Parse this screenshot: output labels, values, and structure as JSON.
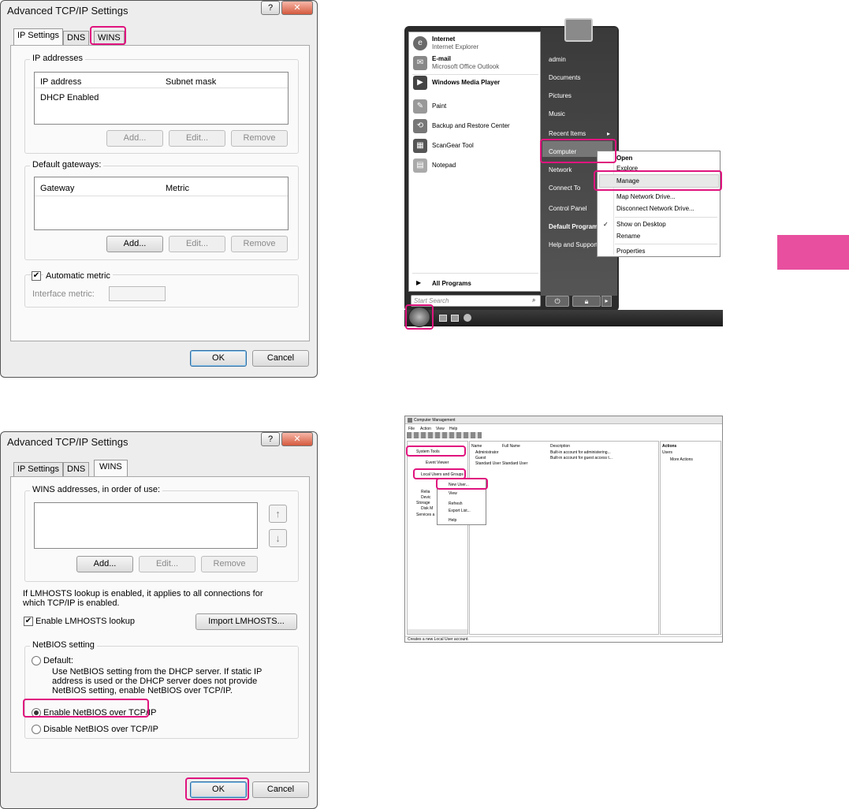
{
  "dialog1": {
    "title": "Advanced TCP/IP Settings",
    "help_label": "?",
    "close_label": "✕",
    "tabs": [
      "IP Settings",
      "DNS",
      "WINS"
    ],
    "ip_group_label": "IP addresses",
    "ip_columns": [
      "IP address",
      "Subnet mask"
    ],
    "ip_rows": [
      "DHCP Enabled"
    ],
    "ip_buttons": [
      "Add...",
      "Edit...",
      "Remove"
    ],
    "gw_group_label": "Default gateways:",
    "gw_columns": [
      "Gateway",
      "Metric"
    ],
    "gw_buttons": [
      "Add...",
      "Edit...",
      "Remove"
    ],
    "auto_metric_label": "Automatic metric",
    "auto_metric_checked": true,
    "interface_metric_label": "Interface metric:",
    "ok_label": "OK",
    "cancel_label": "Cancel"
  },
  "dialog2": {
    "title": "Advanced TCP/IP Settings",
    "help_label": "?",
    "close_label": "✕",
    "tabs": [
      "IP Settings",
      "DNS",
      "WINS"
    ],
    "wins_group_label": "WINS addresses, in order of use:",
    "up_icon": "↑",
    "down_icon": "↓",
    "wins_buttons": [
      "Add...",
      "Edit...",
      "Remove"
    ],
    "lmhosts_text": "If LMHOSTS lookup is enabled, it applies to all connections for which TCP/IP is enabled.",
    "lmhosts_checkbox": "Enable LMHOSTS lookup",
    "lmhosts_checked": true,
    "import_button": "Import LMHOSTS...",
    "netbios_group_label": "NetBIOS setting",
    "netbios_default": "Default:",
    "netbios_default_desc": "Use NetBIOS setting from the DHCP server. If static IP address is used or the DHCP server does not provide NetBIOS setting, enable NetBIOS over TCP/IP.",
    "netbios_enable": "Enable NetBIOS over TCP/IP",
    "netbios_disable": "Disable NetBIOS over TCP/IP",
    "ok_label": "OK",
    "cancel_label": "Cancel"
  },
  "start_menu": {
    "pinned": [
      {
        "title": "Internet",
        "sub": "Internet Explorer",
        "icon": "internet-explorer-icon"
      },
      {
        "title": "E-mail",
        "sub": "Microsoft Office Outlook",
        "icon": "outlook-icon"
      }
    ],
    "recent": [
      "Windows Media Player",
      "Paint",
      "Backup and Restore Center",
      "ScanGear Tool",
      "Notepad"
    ],
    "all_programs": "All Programs",
    "search_placeholder": "Start Search",
    "right_items": [
      "admin",
      "Documents",
      "Pictures",
      "Music",
      "Recent Items",
      "Computer",
      "Network",
      "Connect To",
      "Control Panel",
      "Default Programs",
      "Help and Support"
    ],
    "context_menu": [
      "Open",
      "Explore",
      "Manage",
      "Map Network Drive...",
      "Disconnect Network Drive...",
      "Show on Desktop",
      "Rename",
      "Properties"
    ]
  },
  "computer_management": {
    "title": "Computer Management",
    "menu": [
      "File",
      "Action",
      "View",
      "Help"
    ],
    "tree": [
      "System Tools",
      "Event Viewer",
      "Local Users and Groups",
      "Relia",
      "Devic",
      "Storage",
      "Disk M",
      "Services a"
    ],
    "columns": [
      "Name",
      "Full Name",
      "Description"
    ],
    "rows": [
      [
        "Administrator",
        "",
        "Built-in account for administering..."
      ],
      [
        "Guest",
        "",
        "Built-in account for guest access t..."
      ],
      [
        "Standard User",
        "Standard User",
        ""
      ]
    ],
    "context_menu": [
      "New User...",
      "View",
      "Refresh",
      "Export List...",
      "Help"
    ],
    "actions_title": "Actions",
    "actions_sub": "Users",
    "actions_more": "More Actions",
    "status": "Creates a new Local User account."
  },
  "colors": {
    "highlight": "#e0147e"
  }
}
